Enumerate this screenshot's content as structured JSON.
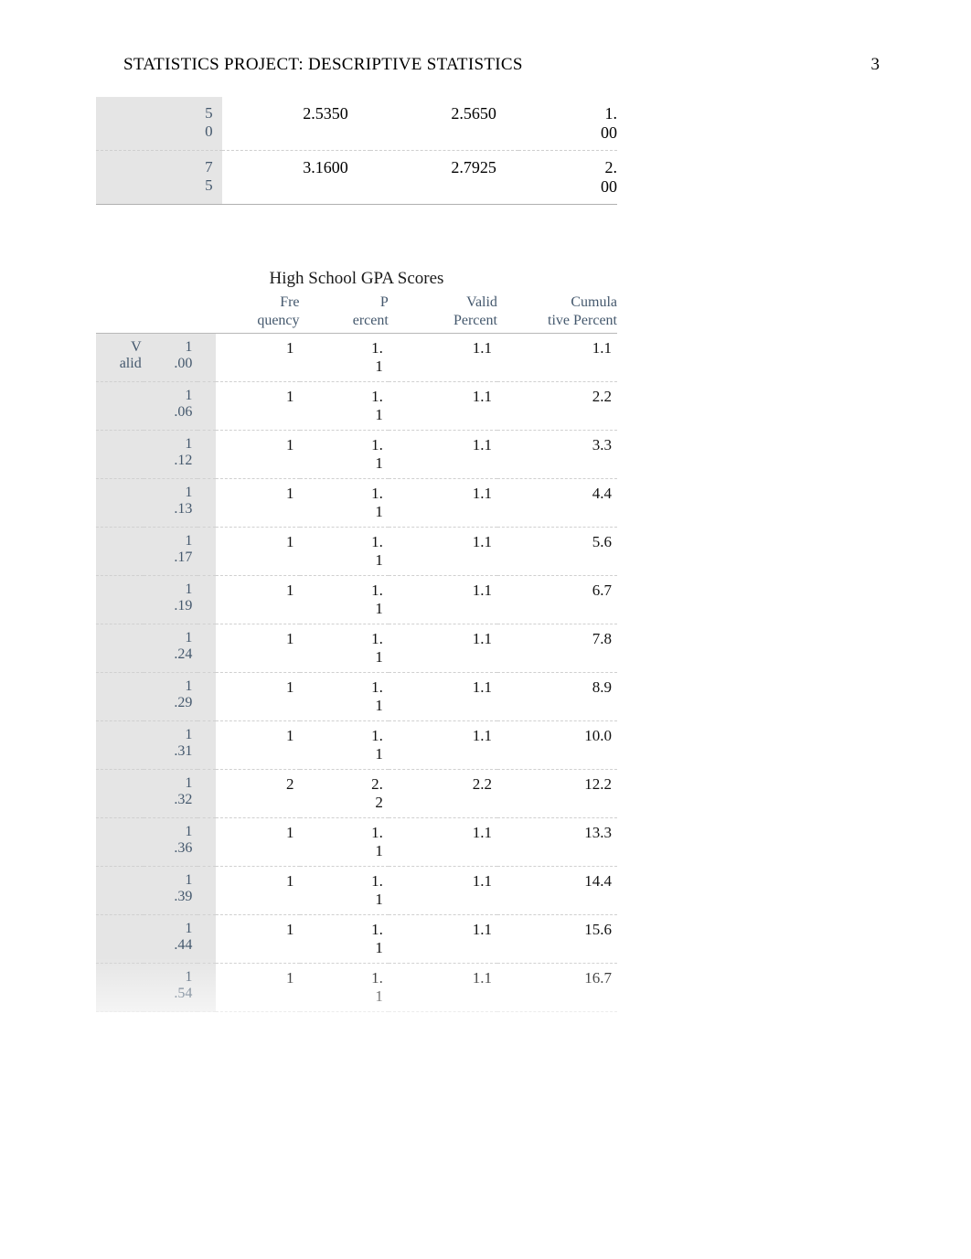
{
  "header": {
    "running_head": "STATISTICS PROJECT: DESCRIPTIVE STATISTICS",
    "page_number": "3"
  },
  "top_table": {
    "rows": [
      {
        "pctile_a": "5",
        "pctile_b": "0",
        "v1": "2.5350",
        "v2": "2.5650",
        "v3a": "1.",
        "v3b": "00"
      },
      {
        "pctile_a": "7",
        "pctile_b": "5",
        "v1": "3.1600",
        "v2": "2.7925",
        "v3a": "2.",
        "v3b": "00"
      }
    ]
  },
  "freq": {
    "title": "High School GPA Scores",
    "headers": {
      "c1a": "Fre",
      "c1b": "quency",
      "c2a": "P",
      "c2b": "ercent",
      "c3a": "Valid",
      "c3b": "Percent",
      "c4a": "Cumula",
      "c4b": "tive Percent"
    },
    "left_label_a": "V",
    "left_label_b": "alid",
    "rows": [
      {
        "val_a": "1",
        "val_b": ".00",
        "freq": "1",
        "pct_a": "1.",
        "pct_b": "1",
        "valid": "1.1",
        "cum": "1.1"
      },
      {
        "val_a": "1",
        "val_b": ".06",
        "freq": "1",
        "pct_a": "1.",
        "pct_b": "1",
        "valid": "1.1",
        "cum": "2.2"
      },
      {
        "val_a": "1",
        "val_b": ".12",
        "freq": "1",
        "pct_a": "1.",
        "pct_b": "1",
        "valid": "1.1",
        "cum": "3.3"
      },
      {
        "val_a": "1",
        "val_b": ".13",
        "freq": "1",
        "pct_a": "1.",
        "pct_b": "1",
        "valid": "1.1",
        "cum": "4.4"
      },
      {
        "val_a": "1",
        "val_b": ".17",
        "freq": "1",
        "pct_a": "1.",
        "pct_b": "1",
        "valid": "1.1",
        "cum": "5.6"
      },
      {
        "val_a": "1",
        "val_b": ".19",
        "freq": "1",
        "pct_a": "1.",
        "pct_b": "1",
        "valid": "1.1",
        "cum": "6.7"
      },
      {
        "val_a": "1",
        "val_b": ".24",
        "freq": "1",
        "pct_a": "1.",
        "pct_b": "1",
        "valid": "1.1",
        "cum": "7.8"
      },
      {
        "val_a": "1",
        "val_b": ".29",
        "freq": "1",
        "pct_a": "1.",
        "pct_b": "1",
        "valid": "1.1",
        "cum": "8.9"
      },
      {
        "val_a": "1",
        "val_b": ".31",
        "freq": "1",
        "pct_a": "1.",
        "pct_b": "1",
        "valid": "1.1",
        "cum": "10.0"
      },
      {
        "val_a": "1",
        "val_b": ".32",
        "freq": "2",
        "pct_a": "2.",
        "pct_b": "2",
        "valid": "2.2",
        "cum": "12.2"
      },
      {
        "val_a": "1",
        "val_b": ".36",
        "freq": "1",
        "pct_a": "1.",
        "pct_b": "1",
        "valid": "1.1",
        "cum": "13.3"
      },
      {
        "val_a": "1",
        "val_b": ".39",
        "freq": "1",
        "pct_a": "1.",
        "pct_b": "1",
        "valid": "1.1",
        "cum": "14.4"
      },
      {
        "val_a": "1",
        "val_b": ".44",
        "freq": "1",
        "pct_a": "1.",
        "pct_b": "1",
        "valid": "1.1",
        "cum": "15.6"
      },
      {
        "val_a": "1",
        "val_b": ".54",
        "freq": "1",
        "pct_a": "1.",
        "pct_b": "1",
        "valid": "1.1",
        "cum": "16.7"
      }
    ]
  }
}
